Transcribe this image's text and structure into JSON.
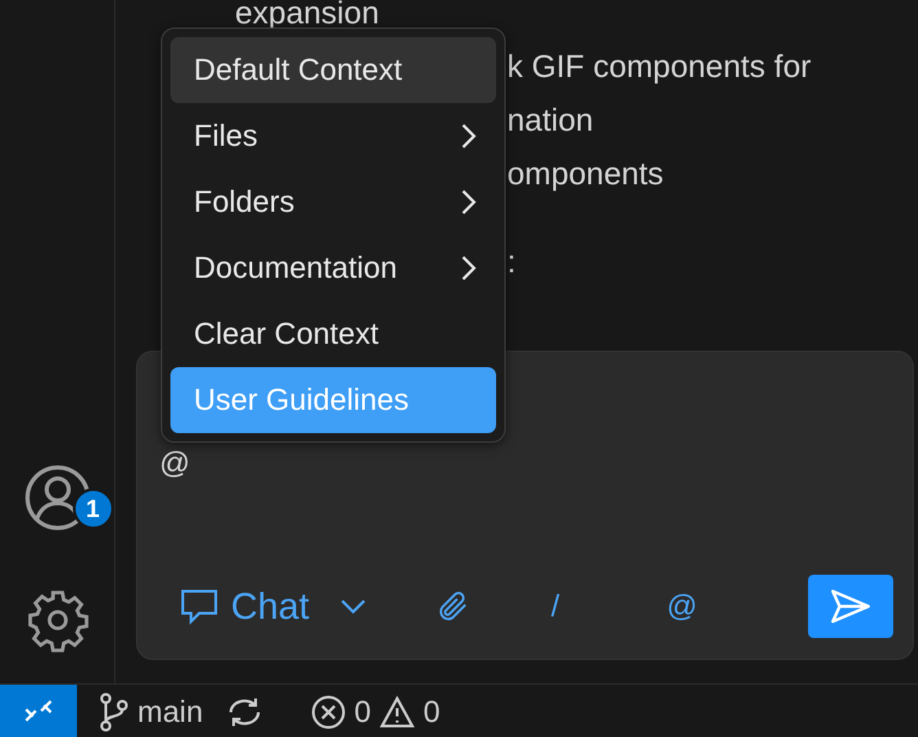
{
  "editor_text": {
    "lines": [
      "expansion",
      "k GIF components for",
      "nation",
      "omponents"
    ],
    "colon": ":"
  },
  "context_menu": {
    "items": [
      {
        "label": "Default Context",
        "submenu": false,
        "highlighted": true,
        "selected": false
      },
      {
        "label": "Files",
        "submenu": true,
        "highlighted": false,
        "selected": false
      },
      {
        "label": "Folders",
        "submenu": true,
        "highlighted": false,
        "selected": false
      },
      {
        "label": "Documentation",
        "submenu": true,
        "highlighted": false,
        "selected": false
      },
      {
        "label": "Clear Context",
        "submenu": false,
        "highlighted": false,
        "selected": false
      },
      {
        "label": "User Guidelines",
        "submenu": false,
        "highlighted": false,
        "selected": true
      }
    ]
  },
  "chat_input": {
    "value": "@"
  },
  "chat_toolbar": {
    "mode": "Chat",
    "slash": "/",
    "mention": "@"
  },
  "activity_bar": {
    "account_badge": "1"
  },
  "status_bar": {
    "branch": "main",
    "errors": "0",
    "warnings": "0"
  }
}
